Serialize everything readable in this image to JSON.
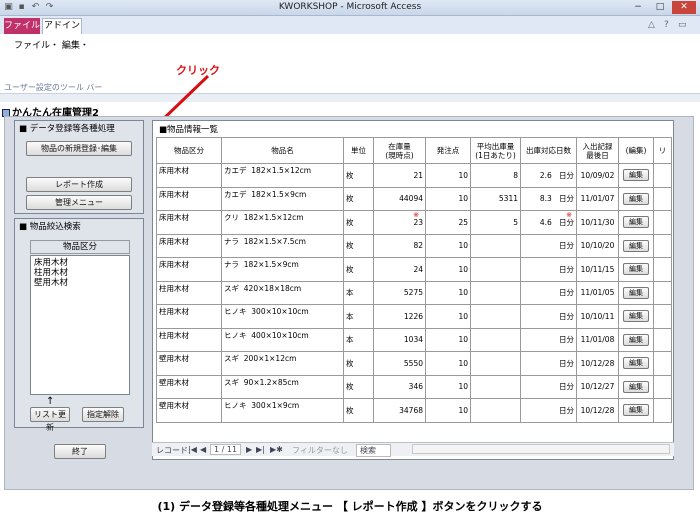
{
  "window": {
    "title": "KWORKSHOP - Microsoft Access",
    "controls": [
      "−",
      "□",
      "✕"
    ]
  },
  "ribbon": {
    "tabs": [
      {
        "label": "ファイル",
        "active": false
      },
      {
        "label": "アドイン",
        "active": true
      }
    ],
    "menu": "ファイル・ 編集・",
    "toolbar_caption": "ユーザー設定のツール バー"
  },
  "annotation": {
    "callout": "クリック",
    "caption": "(1) データ登録等各種処理メニュー 【 レポート作成 】ボタンをクリックする",
    "accent_color": "#e01010"
  },
  "form": {
    "title": "かんたん在庫管理2",
    "processing_group": {
      "title": "■ データ登録等各種処理",
      "buttons": [
        "物品の新規登録･編集",
        "レポート作成",
        "管理メニュー"
      ]
    },
    "search_group": {
      "title": "■ 物品絞込検索",
      "category_label": "物品区分",
      "categories": [
        "床用木材",
        "柱用木材",
        "壁用木材"
      ],
      "arrow": "↑",
      "refresh_button": "リスト更新",
      "clear_button": "指定解除"
    },
    "exit_button": "終了",
    "table_panel": {
      "title": "■物品情報一覧",
      "headers": [
        "物品区分",
        "物品名",
        "単位",
        "在庫量\n(現時点)",
        "発注点",
        "平均出庫量\n(1日あたり)",
        "出庫対応日数",
        "入出記録\n最後日",
        "(編集)",
        "リ"
      ],
      "rows": [
        {
          "category": "床用木材",
          "type": "カエデ",
          "size": "182×1.5×12cm",
          "unit": "枚",
          "stock": "21",
          "order_point": "10",
          "avg_out": "8",
          "days": "2.6",
          "days_unit": "日分",
          "last_date": "10/09/02",
          "edit": "編集",
          "warn": false
        },
        {
          "category": "床用木材",
          "type": "カエデ",
          "size": "182×1.5×9cm",
          "unit": "枚",
          "stock": "44094",
          "order_point": "10",
          "avg_out": "5311",
          "days": "8.3",
          "days_unit": "日分",
          "last_date": "11/01/07",
          "edit": "編集",
          "warn": false
        },
        {
          "category": "床用木材",
          "type": "クリ",
          "size": "182×1.5×12cm",
          "unit": "枚",
          "stock": "23",
          "order_point": "25",
          "avg_out": "5",
          "days": "4.6",
          "days_unit": "日分",
          "last_date": "10/11/30",
          "edit": "編集",
          "warn": true
        },
        {
          "category": "床用木材",
          "type": "ナラ",
          "size": "182×1.5×7.5cm",
          "unit": "枚",
          "stock": "82",
          "order_point": "10",
          "avg_out": "",
          "days": "",
          "days_unit": "日分",
          "last_date": "10/10/20",
          "edit": "編集",
          "warn": false
        },
        {
          "category": "床用木材",
          "type": "ナラ",
          "size": "182×1.5×9cm",
          "unit": "枚",
          "stock": "24",
          "order_point": "10",
          "avg_out": "",
          "days": "",
          "days_unit": "日分",
          "last_date": "10/11/15",
          "edit": "編集",
          "warn": false
        },
        {
          "category": "柱用木材",
          "type": "スギ",
          "size": "420×18×18cm",
          "unit": "本",
          "stock": "5275",
          "order_point": "10",
          "avg_out": "",
          "days": "",
          "days_unit": "日分",
          "last_date": "11/01/05",
          "edit": "編集",
          "warn": false
        },
        {
          "category": "柱用木材",
          "type": "ヒノキ",
          "size": "300×10×10cm",
          "unit": "本",
          "stock": "1226",
          "order_point": "10",
          "avg_out": "",
          "days": "",
          "days_unit": "日分",
          "last_date": "10/10/11",
          "edit": "編集",
          "warn": false
        },
        {
          "category": "柱用木材",
          "type": "ヒノキ",
          "size": "400×10×10cm",
          "unit": "本",
          "stock": "1034",
          "order_point": "10",
          "avg_out": "",
          "days": "",
          "days_unit": "日分",
          "last_date": "11/01/08",
          "edit": "編集",
          "warn": false
        },
        {
          "category": "壁用木材",
          "type": "スギ",
          "size": "200×1×12cm",
          "unit": "枚",
          "stock": "5550",
          "order_point": "10",
          "avg_out": "",
          "days": "",
          "days_unit": "日分",
          "last_date": "10/12/28",
          "edit": "編集",
          "warn": false
        },
        {
          "category": "壁用木材",
          "type": "スギ",
          "size": "90×1.2×85cm",
          "unit": "枚",
          "stock": "346",
          "order_point": "10",
          "avg_out": "",
          "days": "",
          "days_unit": "日分",
          "last_date": "10/12/27",
          "edit": "編集",
          "warn": false
        },
        {
          "category": "壁用木材",
          "type": "ヒノキ",
          "size": "300×1×9cm",
          "unit": "枚",
          "stock": "34768",
          "order_point": "10",
          "avg_out": "",
          "days": "",
          "days_unit": "日分",
          "last_date": "10/12/28",
          "edit": "編集",
          "warn": false
        }
      ],
      "warn_symbol": "※"
    },
    "navigation": {
      "record_label": "レコード:",
      "first": "|◀",
      "prev": "◀",
      "position": "1 / 11",
      "next": "▶",
      "last": "▶|",
      "new": "▶✱",
      "filter": "フィルターなし",
      "search": "検索"
    }
  }
}
